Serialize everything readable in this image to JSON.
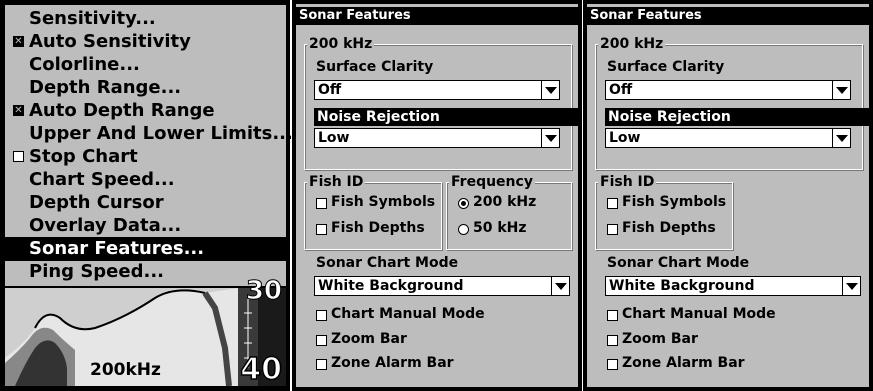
{
  "menu": {
    "items": [
      {
        "label": "Sensitivity...",
        "check": null
      },
      {
        "label": "Auto Sensitivity",
        "check": true
      },
      {
        "label": "Colorline...",
        "check": null
      },
      {
        "label": "Depth Range...",
        "check": null
      },
      {
        "label": "Auto Depth Range",
        "check": true
      },
      {
        "label": "Upper And Lower Limits...",
        "check": null
      },
      {
        "label": "Stop Chart",
        "check": false
      },
      {
        "label": "Chart Speed...",
        "check": null
      },
      {
        "label": "Depth Cursor",
        "check": null
      },
      {
        "label": "Overlay Data...",
        "check": null
      },
      {
        "label": "Sonar Features...",
        "check": null,
        "selected": true
      },
      {
        "label": "Ping Speed...",
        "check": null
      }
    ]
  },
  "sonar_view": {
    "frequency": "200kHz",
    "depth_top": "30",
    "depth_bottom": "40"
  },
  "dialog_left": {
    "title": "Sonar Features",
    "group_200": "200 kHz",
    "surface_clarity_label": "Surface Clarity",
    "surface_clarity_value": "Off",
    "noise_rejection_label": "Noise Rejection",
    "noise_rejection_value": "Low",
    "fish_id_label": "Fish ID",
    "fish_symbols": "Fish Symbols",
    "fish_depths": "Fish Depths",
    "frequency_label": "Frequency",
    "freq_200": "200 kHz",
    "freq_50": "50 kHz",
    "chart_mode_label": "Sonar Chart Mode",
    "chart_mode_value": "White Background",
    "chart_manual": "Chart Manual Mode",
    "zoom_bar": "Zoom Bar",
    "zone_alarm_bar": "Zone Alarm Bar"
  },
  "dialog_right": {
    "title": "Sonar Features",
    "group_200": "200 kHz",
    "surface_clarity_label": "Surface Clarity",
    "surface_clarity_value": "Off",
    "noise_rejection_label": "Noise Rejection",
    "noise_rejection_value": "Low",
    "fish_id_label": "Fish ID",
    "fish_symbols": "Fish Symbols",
    "fish_depths": "Fish Depths",
    "chart_mode_label": "Sonar Chart Mode",
    "chart_mode_value": "White Background",
    "chart_manual": "Chart Manual Mode",
    "zoom_bar": "Zoom Bar",
    "zone_alarm_bar": "Zone Alarm Bar"
  },
  "colors": {
    "background": "#bdbdbd",
    "highlight": "#000000",
    "frame": "#000000"
  }
}
